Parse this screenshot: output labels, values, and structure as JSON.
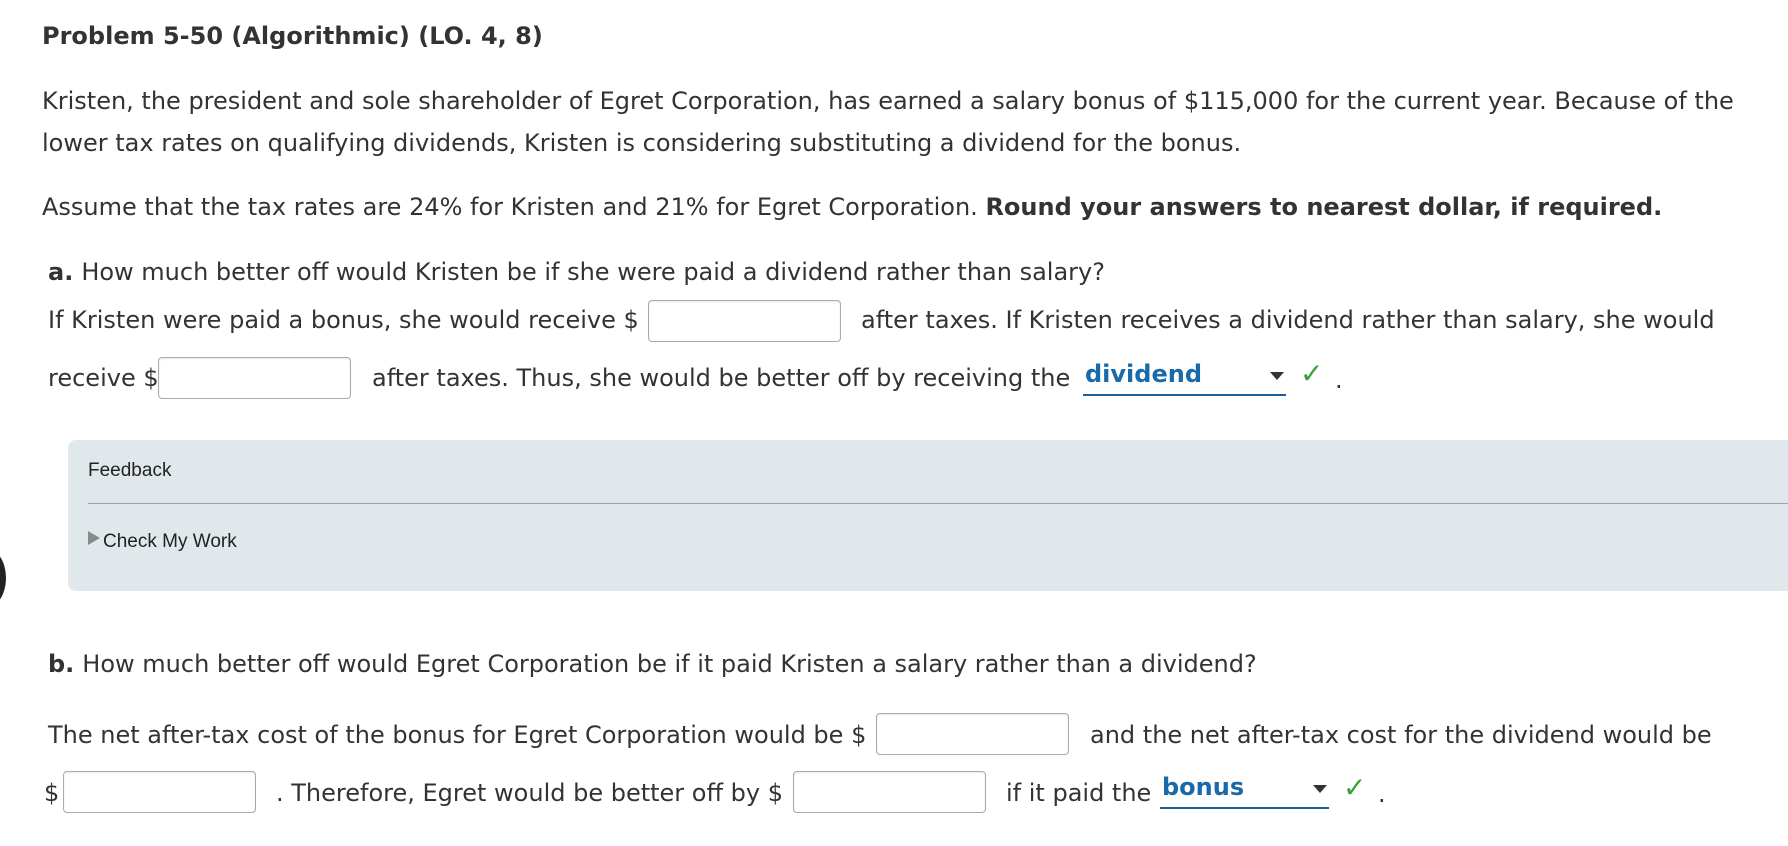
{
  "problem": {
    "title": "Problem 5-50 (Algorithmic) (LO. 4, 8)",
    "intro": "Kristen, the president and sole shareholder of Egret Corporation, has earned a salary bonus of $115,000 for the current year. Because of the lower tax rates on qualifying dividends, Kristen is considering substituting a dividend for the bonus.",
    "assume": "Assume that the tax rates are 24% for Kristen and 21% for Egret Corporation.",
    "assume_bold": "Round your answers to nearest dollar, if required."
  },
  "part_a": {
    "letter": "a.",
    "question": "How much better off would Kristen be if she were paid a dividend rather than salary?",
    "line1_pre": "If Kristen were paid a bonus, she would receive $",
    "line1_post": "after taxes. If Kristen receives a dividend rather than salary, she would",
    "line2_pre": "receive $",
    "line2_post": "after taxes. Thus, she would be better off by receiving the",
    "bonus_after_tax": "",
    "dividend_after_tax": "",
    "select_value": "dividend",
    "end": "."
  },
  "feedback": {
    "title": "Feedback",
    "toggle": "Check My Work"
  },
  "part_b": {
    "letter": "b.",
    "question": "How much better off would Egret Corporation be if it paid Kristen a salary rather than a dividend?",
    "line1_pre": "The net after-tax cost of the bonus for Egret Corporation would be $",
    "line1_post": "and the net after-tax cost for the dividend would be",
    "line2_pre": "$",
    "line2_mid": ". Therefore, Egret would be better off by $",
    "line2_post": "if it paid the",
    "bonus_cost": "",
    "dividend_cost": "",
    "better_off": "",
    "select_value": "bonus",
    "end": "."
  },
  "colors": {
    "select_text": "#1a6aa9",
    "check": "#3aa23a",
    "feedback_bg": "#e1e8ec"
  },
  "icons": {
    "check": "check-icon",
    "caret": "caret-down-icon",
    "triangle": "triangle-right-icon"
  }
}
